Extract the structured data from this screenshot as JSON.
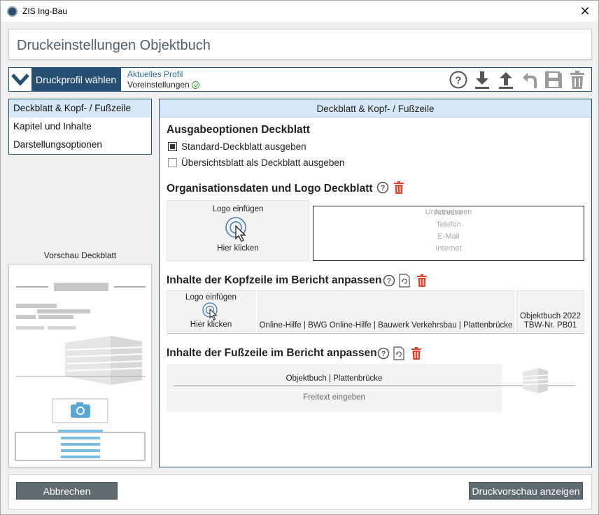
{
  "window": {
    "title": "ZIS Ing-Bau",
    "close": "✕"
  },
  "heading": "Druckeinstellungen Objektbuch",
  "profile": {
    "button_label": "Druckprofil wählen",
    "current_label": "Aktuelles Profil",
    "current_value": "Voreinstellungen"
  },
  "toolbar": [
    "help-icon",
    "download-icon",
    "upload-icon",
    "undo-icon",
    "save-icon",
    "delete-icon"
  ],
  "nav": {
    "items": [
      {
        "label": "Deckblatt & Kopf- / Fußzeile",
        "active": true
      },
      {
        "label": "Kapitel und Inhalte",
        "active": false
      },
      {
        "label": "Darstellungsoptionen",
        "active": false
      }
    ]
  },
  "preview": {
    "label": "Vorschau Deckblatt"
  },
  "panel": {
    "title": "Deckblatt & Kopf- / Fußzeile",
    "ausgabe": {
      "title": "Ausgabeoptionen Deckblatt",
      "options": [
        {
          "label": "Standard-Deckblatt ausgeben",
          "checked": true
        },
        {
          "label": "Übersichtsblatt als Deckblatt ausgeben",
          "checked": false
        }
      ]
    },
    "org": {
      "title": "Organisationsdaten und Logo Deckblatt",
      "logo_top": "Logo einfügen",
      "logo_bottom": "Hier klicken",
      "fields": [
        "Unternehmen",
        "Adresse",
        "Telefon",
        "E-Mail",
        "Internet"
      ]
    },
    "kopf": {
      "title": "Inhalte der Kopfzeile im Bericht anpassen",
      "logo_top": "Logo einfügen",
      "logo_bottom": "Hier klicken",
      "middle": "Online-Hilfe | BWG Online-Hilfe | Bauwerk Verkehrsbau | Plattenbrücke",
      "right_line1": "Objektbuch 2022",
      "right_line2": "TBW-Nr. PB01"
    },
    "fuss": {
      "title": "Inhalte der Fußzeile im Bericht anpassen",
      "text": "Objektbuch | Plattenbrücke",
      "placeholder": "Freitext eingeben"
    }
  },
  "footer": {
    "cancel": "Abbrechen",
    "preview": "Druckvorschau anzeigen"
  },
  "colors": {
    "accent": "#274f73",
    "delete": "#e0452e",
    "header_bg": "#d6e8f7",
    "button": "#5f6b73"
  }
}
